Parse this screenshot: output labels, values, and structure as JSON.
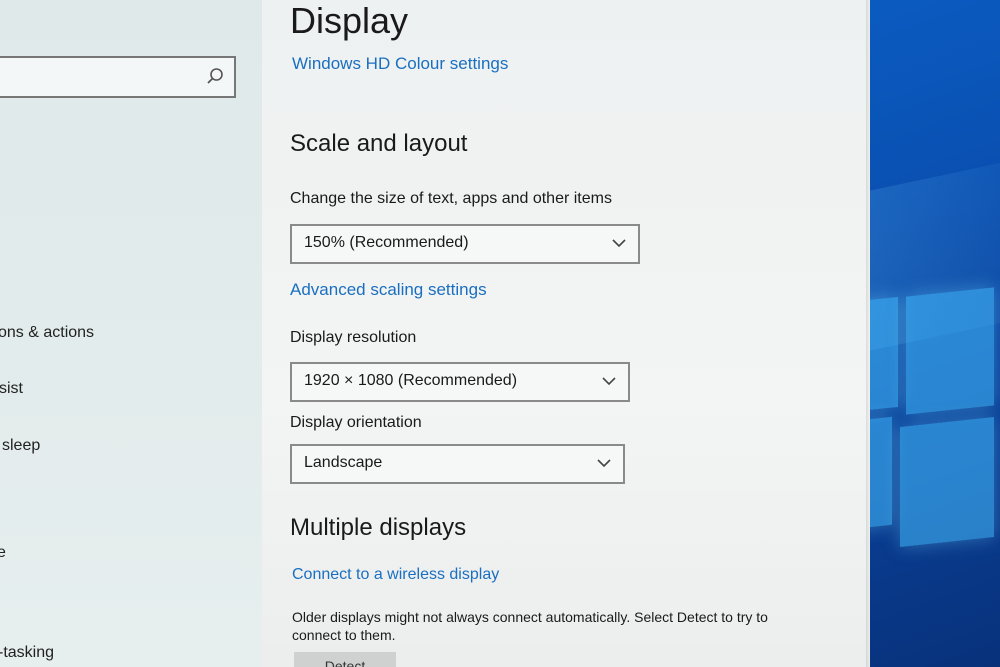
{
  "sidebar": {
    "search": {
      "placeholder": ""
    },
    "items": [
      {
        "label": "ons & actions"
      },
      {
        "label": "sist"
      },
      {
        "label": "sleep"
      },
      {
        "label": "e"
      },
      {
        "label": "-tasking"
      }
    ]
  },
  "main": {
    "title": "Display",
    "hd_colour_link": "Windows HD Colour settings",
    "scale_section": {
      "title": "Scale and layout",
      "size_label": "Change the size of text, apps and other items",
      "size_value": "150% (Recommended)",
      "advanced_link": "Advanced scaling settings",
      "resolution_label": "Display resolution",
      "resolution_value": "1920 × 1080 (Recommended)",
      "orientation_label": "Display orientation",
      "orientation_value": "Landscape"
    },
    "multiple_section": {
      "title": "Multiple displays",
      "wireless_link": "Connect to a wireless display",
      "description": "Older displays might not always connect automatically. Select Detect to try to connect to them.",
      "detect_button": "Detect"
    }
  },
  "icons": {
    "search": "search-icon",
    "chevron": "chevron-down-icon",
    "wallpaper_logo": "windows-logo"
  },
  "colors": {
    "link": "#1a6fc0",
    "wallpaper": "#0a4fb0"
  }
}
